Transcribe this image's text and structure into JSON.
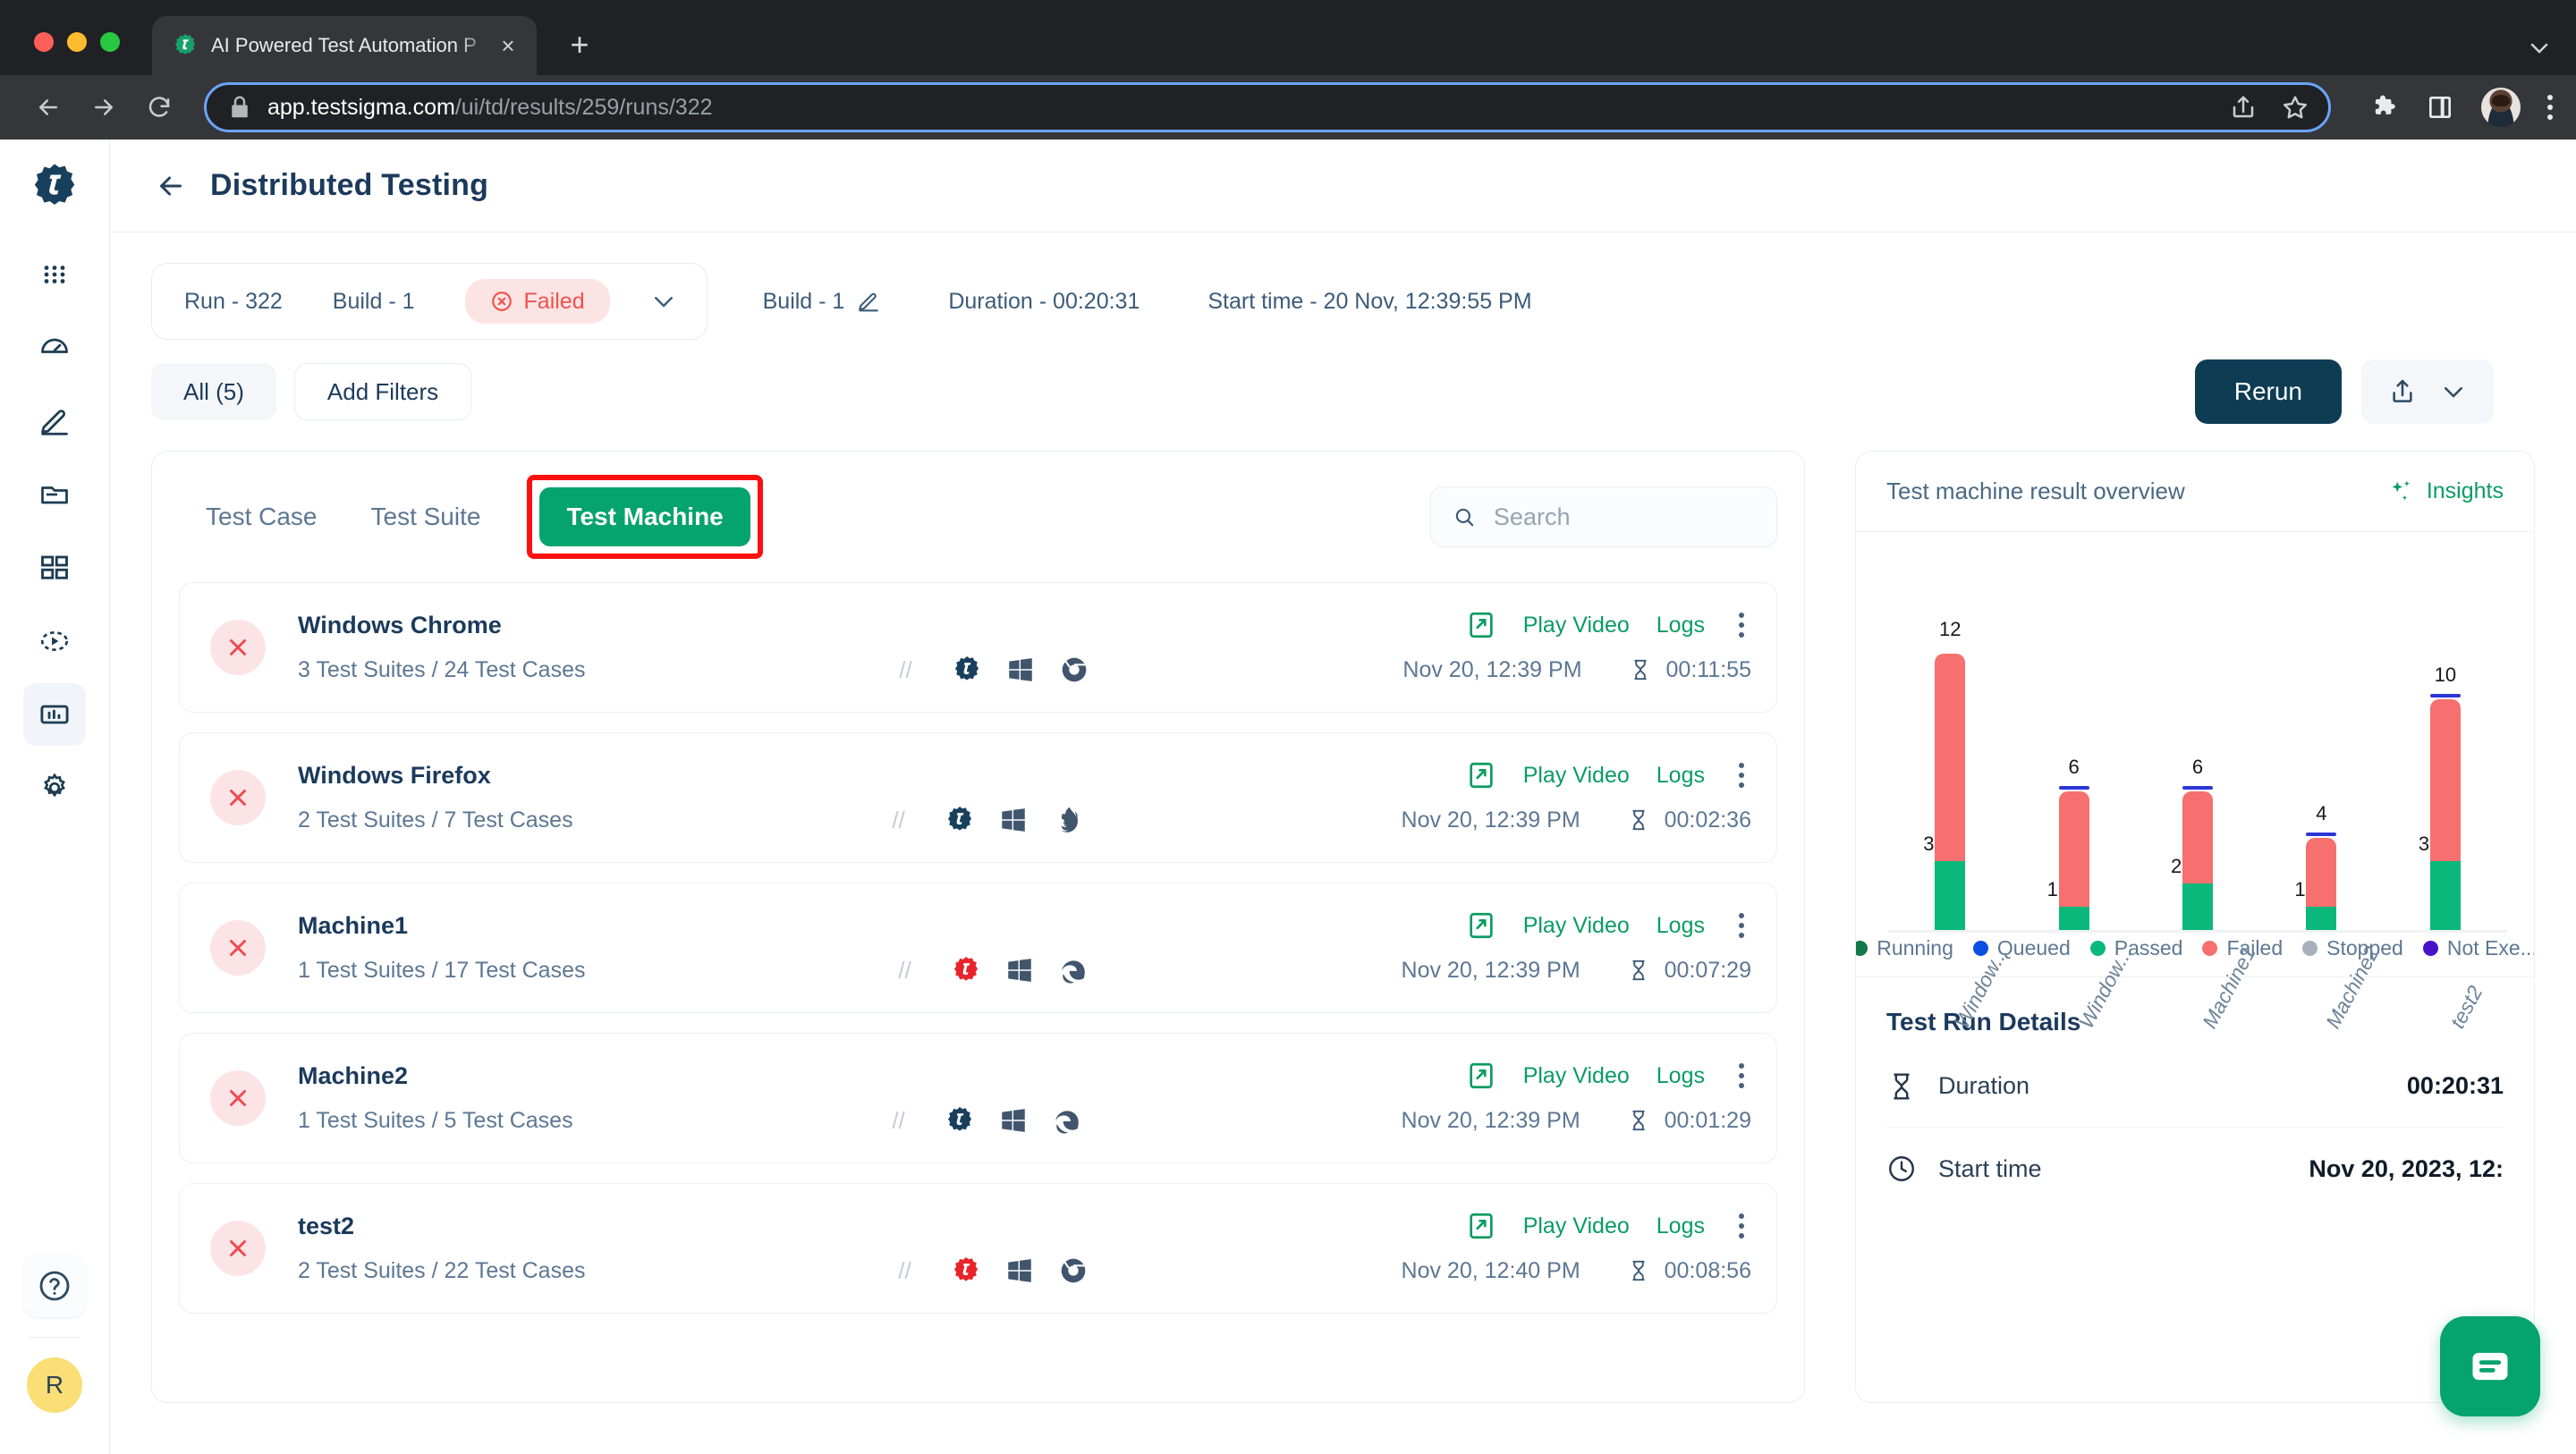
{
  "browser": {
    "tab_title": "AI Powered Test Automation P",
    "url_domain": "app.testsigma.com",
    "url_path": "/ui/td/results/259/runs/322",
    "new_tab_label": "+",
    "close_tab_label": "×"
  },
  "page": {
    "title": "Distributed Testing"
  },
  "run_bar": {
    "run": "Run - 322",
    "build": "Build - 1",
    "status": "Failed",
    "build_edit": "Build - 1",
    "duration": "Duration - 00:20:31",
    "start_time": "Start time - 20 Nov, 12:39:55 PM"
  },
  "filters": {
    "all": "All (5)",
    "add_filters": "Add Filters"
  },
  "actions": {
    "rerun": "Rerun"
  },
  "tabs": [
    {
      "label": "Test Case",
      "active": false
    },
    {
      "label": "Test Suite",
      "active": false
    },
    {
      "label": "Test Machine",
      "active": true
    }
  ],
  "search": {
    "placeholder": "Search",
    "value": ""
  },
  "rows": [
    {
      "name": "Windows Chrome",
      "subtitle": "3 Test Suites / 24 Test Cases",
      "play_video": "Play Video",
      "logs": "Logs",
      "date": "Nov 20, 12:39 PM",
      "duration": "00:11:55",
      "status": "failed",
      "platform_icons": [
        "testsigma-icon",
        "windows-icon",
        "chrome-icon"
      ]
    },
    {
      "name": "Windows Firefox",
      "subtitle": "2 Test Suites / 7 Test Cases",
      "play_video": "Play Video",
      "logs": "Logs",
      "date": "Nov 20, 12:39 PM",
      "duration": "00:02:36",
      "status": "failed",
      "platform_icons": [
        "testsigma-icon",
        "windows-icon",
        "firefox-icon"
      ]
    },
    {
      "name": "Machine1",
      "subtitle": "1 Test Suites / 17 Test Cases",
      "play_video": "Play Video",
      "logs": "Logs",
      "date": "Nov 20, 12:39 PM",
      "duration": "00:07:29",
      "status": "failed",
      "platform_icons": [
        "testsigma-red-icon",
        "windows-icon",
        "edge-icon"
      ]
    },
    {
      "name": "Machine2",
      "subtitle": "1 Test Suites / 5 Test Cases",
      "play_video": "Play Video",
      "logs": "Logs",
      "date": "Nov 20, 12:39 PM",
      "duration": "00:01:29",
      "status": "failed",
      "platform_icons": [
        "testsigma-icon",
        "windows-icon",
        "edge-icon"
      ]
    },
    {
      "name": "test2",
      "subtitle": "2 Test Suites / 22 Test Cases",
      "play_video": "Play Video",
      "logs": "Logs",
      "date": "Nov 20, 12:40 PM",
      "duration": "00:08:56",
      "status": "failed",
      "platform_icons": [
        "testsigma-red-icon",
        "windows-icon",
        "chrome-icon"
      ]
    }
  ],
  "overview": {
    "title": "Test machine result overview",
    "insights": "Insights"
  },
  "chart_data": {
    "type": "bar",
    "title": "Test machine result overview",
    "xlabel": "",
    "ylabel": "",
    "stacked": true,
    "grid": false,
    "legend_position": "bottom",
    "categories": [
      "Window...",
      "Window...",
      "Machine1",
      "Machine2",
      "test2"
    ],
    "totals": [
      12,
      6,
      6,
      4,
      10
    ],
    "series": [
      {
        "name": "Passed",
        "color": "#0ab87b",
        "values": [
          3,
          1,
          2,
          1,
          3
        ]
      },
      {
        "name": "Failed",
        "color": "#f5706e",
        "values": [
          9,
          5,
          4,
          3,
          7
        ]
      }
    ],
    "ylim": [
      0,
      13
    ],
    "legend": [
      {
        "label": "Running",
        "color": "#11794a"
      },
      {
        "label": "Queued",
        "color": "#0b4fe0"
      },
      {
        "label": "Passed",
        "color": "#0ab87b"
      },
      {
        "label": "Failed",
        "color": "#f5706e"
      },
      {
        "label": "Stopped",
        "color": "#a7b0bb"
      },
      {
        "label": "Not Exe...",
        "color": "#4713c9"
      }
    ]
  },
  "test_run_details": {
    "title": "Test Run Details",
    "items": [
      {
        "icon": "hourglass-icon",
        "label": "Duration",
        "value": "00:20:31"
      },
      {
        "icon": "clock-icon",
        "label": "Start time",
        "value": "Nov 20, 2023, 12:"
      }
    ]
  },
  "rail": {
    "items": [
      "apps-grid-icon",
      "dashboard-icon",
      "pencil-icon",
      "folder-icon",
      "grid-four-icon",
      "play-circle-icon",
      "bar-chart-icon",
      "settings-gear-icon"
    ],
    "help": "?",
    "avatar_initial": "R"
  }
}
